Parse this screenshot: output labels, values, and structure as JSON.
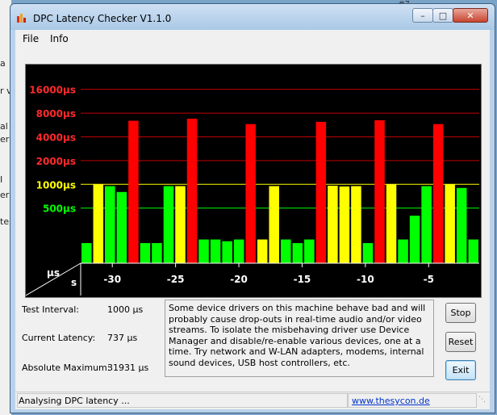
{
  "window": {
    "title": "DPC Latency Checker V1.1.0",
    "icons": {
      "app": "bar-chart-app-icon",
      "minimize": "minimize-icon",
      "maximize": "maximize-icon",
      "close": "close-icon"
    }
  },
  "background": {
    "corner_text": "#7",
    "edge_fragments": [
      "a",
      "r v",
      "al",
      "er",
      "I",
      "er",
      "te"
    ]
  },
  "menu": {
    "file": "File",
    "info": "Info"
  },
  "chart_data": {
    "type": "bar",
    "y_scale": "log",
    "y_ticks": [
      {
        "label": "16000µs",
        "value": 16000,
        "color": "#ff2a2a"
      },
      {
        "label": "8000µs",
        "value": 8000,
        "color": "#ff2a2a"
      },
      {
        "label": "4000µs",
        "value": 4000,
        "color": "#ff2a2a"
      },
      {
        "label": "2000µs",
        "value": 2000,
        "color": "#ff2a2a"
      },
      {
        "label": "1000µs",
        "value": 1000,
        "color": "#ffff00"
      },
      {
        "label": "500µs",
        "value": 500,
        "color": "#00ff00"
      }
    ],
    "x_ticks": [
      "-30",
      "-25",
      "-20",
      "-15",
      "-10",
      "-5"
    ],
    "x_tick_values": [
      -30,
      -25,
      -20,
      -15,
      -10,
      -5
    ],
    "x_range": [
      -32.5,
      -1
    ],
    "y_range": [
      100,
      30000
    ],
    "y_unit": "µs",
    "x_unit": "s",
    "bar_colors": {
      "low": "#00ff00",
      "mid": "#ffff00",
      "high": "#ff0000"
    },
    "values": [
      180,
      1000,
      950,
      800,
      6400,
      180,
      180,
      950,
      950,
      6800,
      200,
      200,
      190,
      200,
      5800,
      200,
      950,
      200,
      180,
      200,
      6200,
      960,
      940,
      950,
      180,
      6500,
      1000,
      200,
      400,
      950,
      5800,
      1000,
      900,
      200
    ],
    "bar_colors_per_value": [
      "low",
      "mid",
      "low",
      "low",
      "high",
      "low",
      "low",
      "low",
      "mid",
      "high",
      "low",
      "low",
      "low",
      "low",
      "high",
      "mid",
      "mid",
      "low",
      "low",
      "low",
      "high",
      "mid",
      "mid",
      "mid",
      "low",
      "high",
      "mid",
      "low",
      "low",
      "low",
      "high",
      "mid",
      "low",
      "low"
    ]
  },
  "stats": {
    "test_interval_label": "Test Interval:",
    "test_interval_value": "1000 µs",
    "current_latency_label": "Current Latency:",
    "current_latency_value": "737 µs",
    "absolute_maximum_label": "Absolute Maximum:",
    "absolute_maximum_value": "31931 µs"
  },
  "message": "Some device drivers on this machine behave bad and will probably cause drop-outs in real-time audio and/or video streams. To isolate the misbehaving driver use Device Manager and disable/re-enable various devices, one at a time. Try network and W-LAN adapters, modems, internal sound devices, USB host controllers, etc.",
  "buttons": {
    "stop": "Stop",
    "reset": "Reset",
    "exit": "Exit"
  },
  "status": {
    "text": "Analysing DPC latency ...",
    "link": "www.thesycon.de"
  }
}
